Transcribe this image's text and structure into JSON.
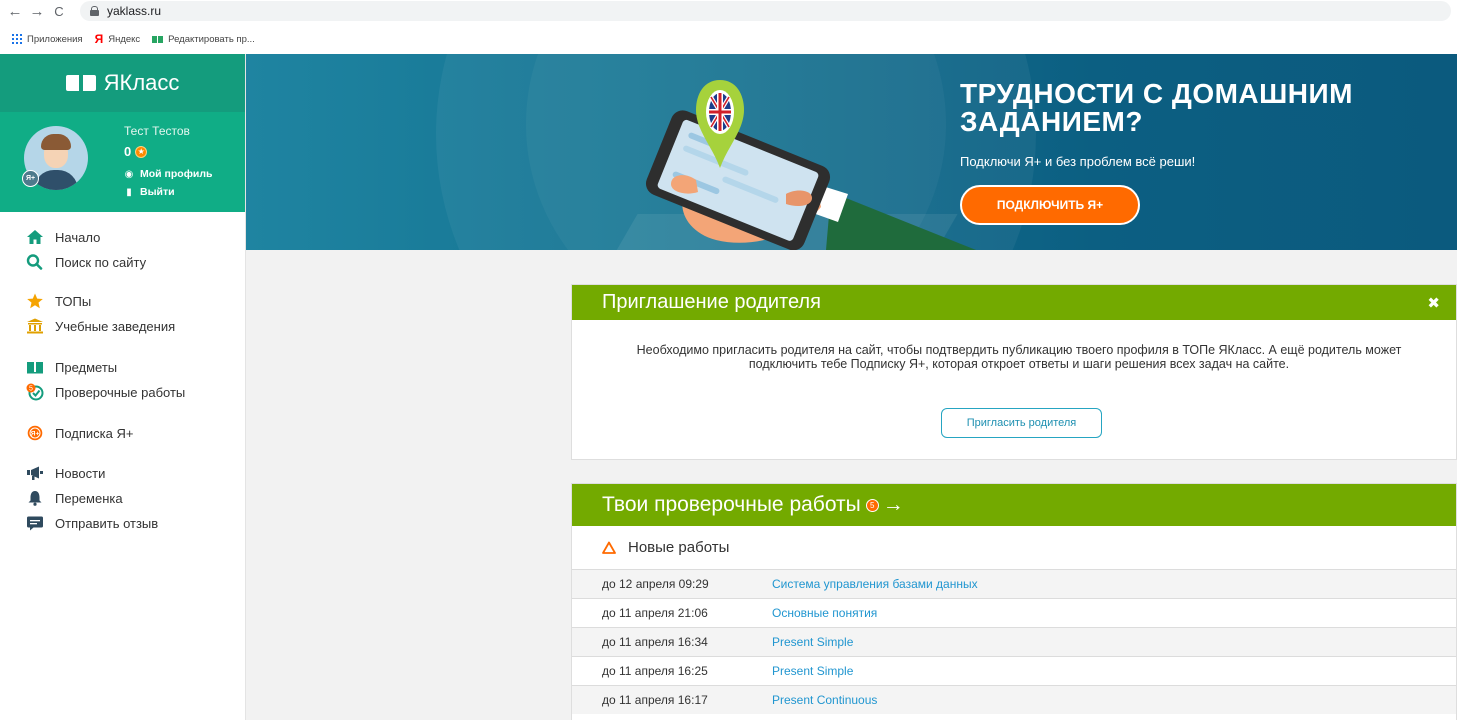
{
  "browser": {
    "back_icon": "←",
    "forward_icon": "→",
    "reload_icon": "C",
    "url": "yaklass.ru",
    "bookmarks": [
      {
        "label": "Приложения"
      },
      {
        "label": "Яндекс"
      },
      {
        "label": "Редактировать пр..."
      }
    ]
  },
  "sidebar": {
    "logo": "ЯКласс",
    "profile": {
      "name": "Тест Тестов",
      "points": "0",
      "badge": "Я+",
      "my_profile": "Мой профиль",
      "logout": "Выйти"
    },
    "items": [
      {
        "label": "Начало",
        "icon": "home-icon"
      },
      {
        "label": "Поиск по сайту",
        "icon": "search-icon"
      },
      {
        "label": "ТОПы",
        "icon": "star-icon"
      },
      {
        "label": "Учебные заведения",
        "icon": "institution-icon"
      },
      {
        "label": "Предметы",
        "icon": "book-icon"
      },
      {
        "label": "Проверочные работы",
        "icon": "tests-icon",
        "badge": "5"
      },
      {
        "label": "Подписка Я+",
        "icon": "subscription-icon"
      },
      {
        "label": "Новости",
        "icon": "megaphone-icon"
      },
      {
        "label": "Переменка",
        "icon": "bell-icon"
      },
      {
        "label": "Отправить отзыв",
        "icon": "feedback-icon"
      }
    ]
  },
  "banner": {
    "title_line1": "ТРУДНОСТИ С ДОМАШНИМ",
    "title_line2": "ЗАДАНИЕМ?",
    "subtitle": "Подключи Я+ и без проблем всё реши!",
    "button": "ПОДКЛЮЧИТЬ Я+"
  },
  "invite": {
    "title": "Приглашение родителя",
    "text": "Необходимо пригласить родителя на сайт, чтобы подтвердить публикацию твоего профиля в ТОПе ЯКласс. А ещё родитель может подключить тебе Подписку Я+, которая откроет ответы и шаги решения всех задач на сайте.",
    "button": "Пригласить родителя"
  },
  "works": {
    "title": "Твои проверочные работы",
    "count": "5",
    "arrow": "→",
    "new_label": "Новые работы",
    "rows": [
      {
        "date": "до 12 апреля 09:29",
        "title": "Система управления базами данных"
      },
      {
        "date": "до 11 апреля 21:06",
        "title": "Основные понятия"
      },
      {
        "date": "до 11 апреля 16:34",
        "title": "Present Simple"
      },
      {
        "date": "до 11 апреля 16:25",
        "title": "Present Simple"
      },
      {
        "date": "до 11 апреля 16:17",
        "title": "Present Continuous"
      }
    ]
  },
  "colors": {
    "brand_green": "#149c7d",
    "card_header_green": "#73aa00",
    "banner_blue": "#12708f",
    "accent_orange": "#ff6a00",
    "link_blue": "#2196d0"
  }
}
